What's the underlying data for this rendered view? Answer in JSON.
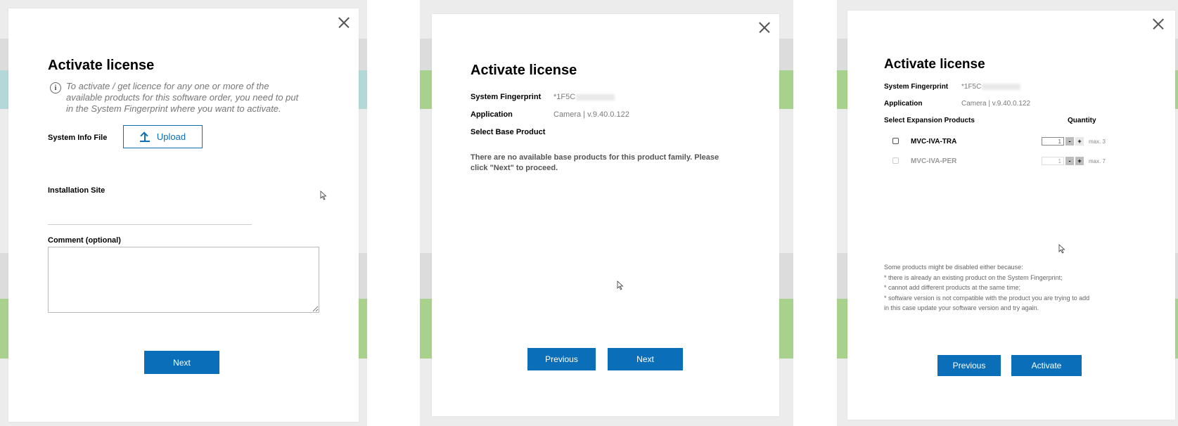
{
  "colors": {
    "primary": "#0a6fb8",
    "overlay": "#ececec",
    "teal_band": "#b2d8d8",
    "green_band": "#a9d18e"
  },
  "modal1": {
    "title": "Activate license",
    "info_icon": "info-icon",
    "info_text": "To activate / get licence for any one or more of the available products for this software order, you need to put in the System Fingerprint where you want to activate.",
    "system_info_file_label": "System Info File",
    "upload_icon": "upload-icon",
    "upload_label": "Upload",
    "installation_site_label": "Installation Site",
    "installation_site_value": "",
    "comment_label": "Comment (optional)",
    "comment_value": "",
    "next_label": "Next",
    "close_icon": "close-icon"
  },
  "modal2": {
    "title": "Activate license",
    "fingerprint_label": "System Fingerprint",
    "fingerprint_value": "*1F5C",
    "application_label": "Application",
    "application_value": "Camera | v.9.40.0.122",
    "base_product_label": "Select Base Product",
    "notice": "There are no available base products for this product family. Please click \"Next\" to proceed.",
    "previous_label": "Previous",
    "next_label": "Next",
    "close_icon": "close-icon"
  },
  "modal3": {
    "title": "Activate license",
    "fingerprint_label": "System Fingerprint",
    "fingerprint_value": "*1F5C",
    "application_label": "Application",
    "application_value": "Camera | v.9.40.0.122",
    "expansion_label": "Select Expansion Products",
    "quantity_header": "Quantity",
    "products": [
      {
        "name": "MVC-IVA-TRA",
        "quantity": "1",
        "max": "max. 3",
        "checked": false,
        "disabled": false
      },
      {
        "name": "MVC-IVA-PER",
        "quantity": "1",
        "max": "max. 7",
        "checked": false,
        "disabled": true
      }
    ],
    "minus_label": "-",
    "plus_label": "+",
    "disclaimer": [
      "Some products might be disabled either because:",
      "* there is already an existing product on the System Fingerprint;",
      "* cannot add different products at the same time;",
      "* software version is not compatible with the product you are trying to add",
      "in this case update your software version and try again."
    ],
    "previous_label": "Previous",
    "activate_label": "Activate",
    "close_icon": "close-icon"
  }
}
